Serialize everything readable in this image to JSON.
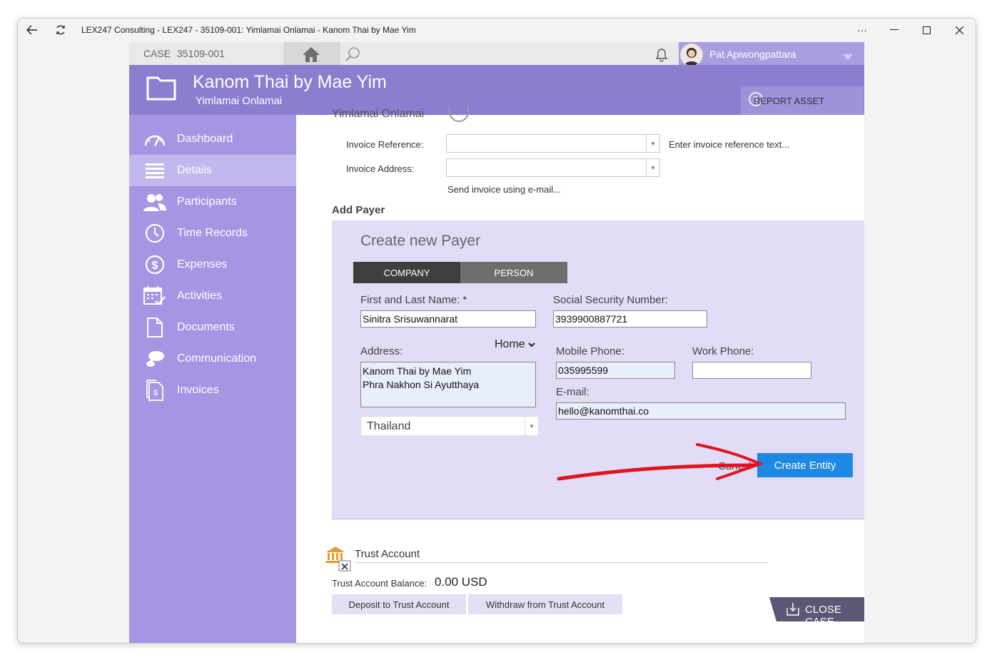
{
  "window": {
    "title": "LEX247 Consulting - LEX247 - 35109-001: Yimlamai Onlamai - Kanom Thai by Mae Yim"
  },
  "topbar": {
    "case_label": "CASE",
    "case_number": "35109-001",
    "user_name": "Pat Apiwongpattara"
  },
  "header": {
    "title": "Kanom Thai by Mae Yim",
    "subtitle": "Yimlamai Onlamai",
    "report_button": "REPORT ASSET"
  },
  "sidebar": {
    "items": [
      {
        "label": "Dashboard",
        "icon": "gauge-icon"
      },
      {
        "label": "Details",
        "icon": "list-icon",
        "active": true
      },
      {
        "label": "Participants",
        "icon": "people-icon"
      },
      {
        "label": "Time Records",
        "icon": "clock-icon"
      },
      {
        "label": "Expenses",
        "icon": "dollar-circle-icon"
      },
      {
        "label": "Activities",
        "icon": "calendar-check-icon"
      },
      {
        "label": "Documents",
        "icon": "document-icon"
      },
      {
        "label": "Communication",
        "icon": "chat-bubble-icon"
      },
      {
        "label": "Invoices",
        "icon": "invoice-icon"
      }
    ]
  },
  "main": {
    "cut_off_text": "Yimlamai Onlamai",
    "invoice_reference_label": "Invoice Reference:",
    "invoice_reference_hint": "Enter invoice reference text...",
    "invoice_address_label": "Invoice Address:",
    "send_invoice_link": "Send invoice using e-mail...",
    "add_payer_heading": "Add Payer"
  },
  "payer_form": {
    "title": "Create new Payer",
    "tab_company": "COMPANY",
    "tab_person": "PERSON",
    "name_label": "First and Last Name: *",
    "name_value": "Sinitra Srisuwannarat",
    "ssn_label": "Social Security Number:",
    "ssn_value": "3939900887721",
    "address_type": "Home",
    "address_label": "Address:",
    "address_line1": "Kanom Thai by Mae Yim",
    "address_line2": "Phra Nakhon Si Ayutthaya",
    "country": "Thailand",
    "mobile_label": "Mobile Phone:",
    "mobile_value": "035995599",
    "work_label": "Work Phone:",
    "work_value": "",
    "email_label": "E-mail:",
    "email_value": "hello@kanomthai.co",
    "cancel_label": "Cancel",
    "create_label": "Create Entity"
  },
  "trust": {
    "title": "Trust Account",
    "balance_label": "Trust Account Balance:",
    "balance_value": "0.00 USD",
    "deposit_button": "Deposit to Trust Account",
    "withdraw_button": "Withdraw from Trust Account"
  },
  "close_case_button": "CLOSE CASE",
  "colors": {
    "header": "#8c7dd0",
    "sidebar": "#a595e3",
    "panel": "#e2dcf7",
    "primary_button": "#1e88e5",
    "annotation_arrow": "#e0141e"
  }
}
